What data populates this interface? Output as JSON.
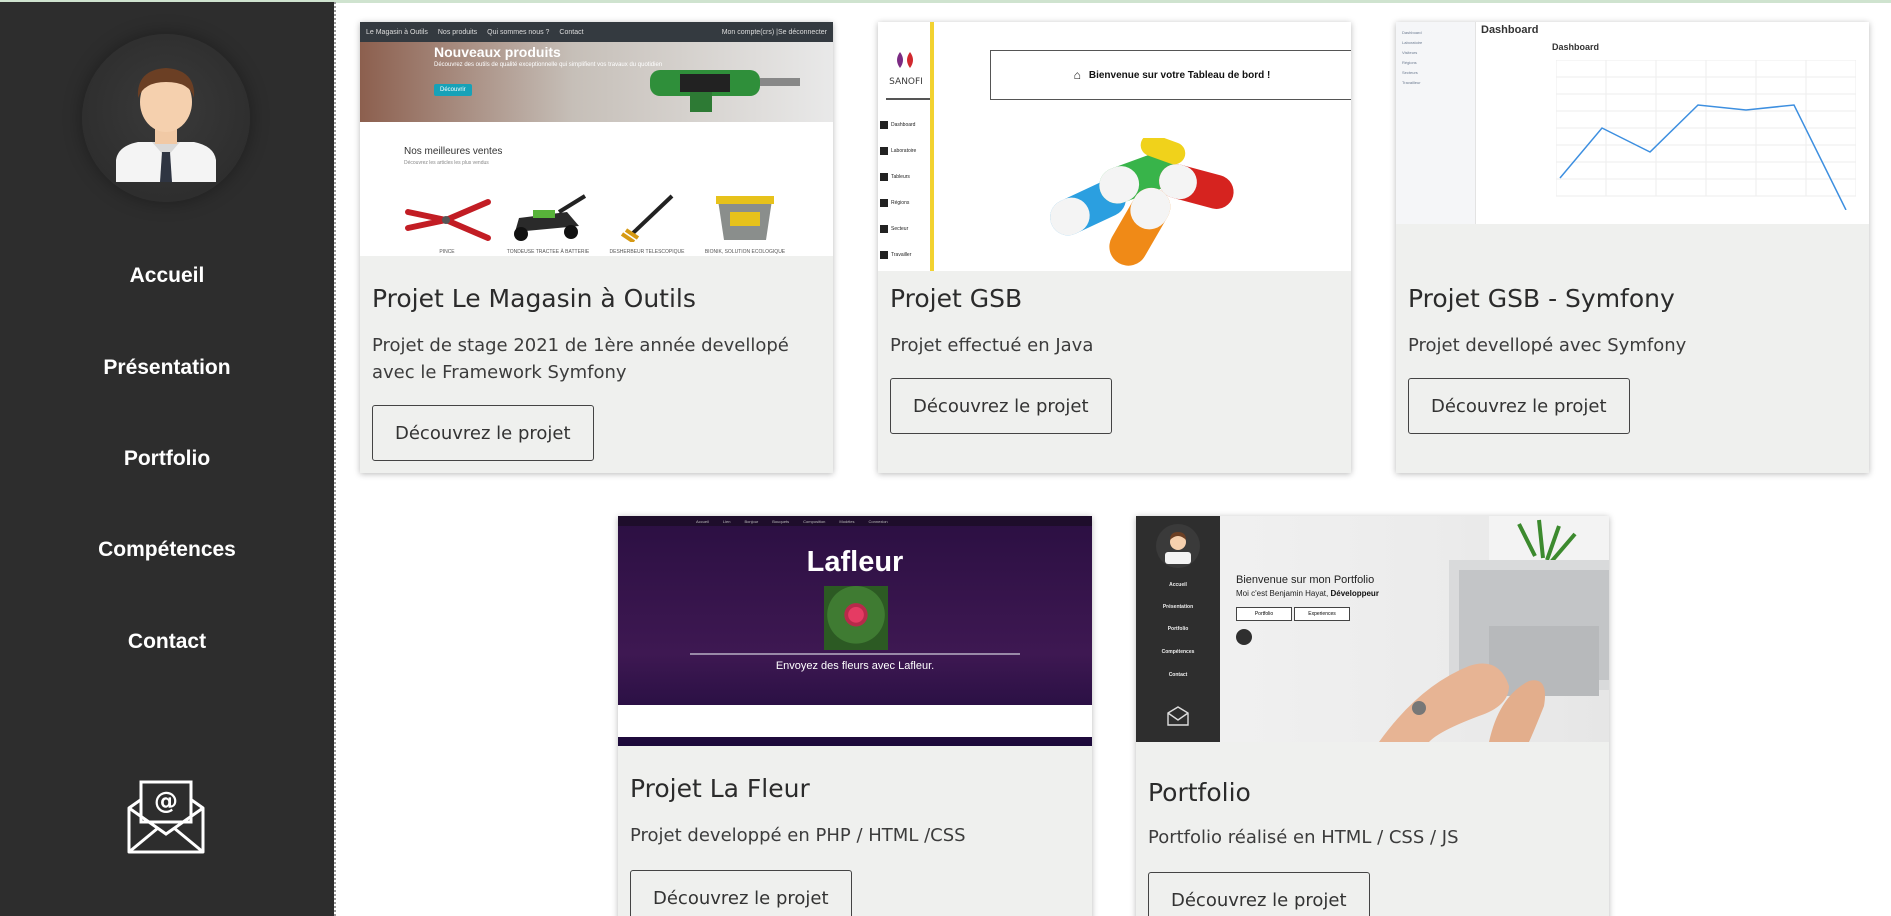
{
  "sidebar": {
    "nav": [
      "Accueil",
      "Présentation",
      "Portfolio",
      "Compétences",
      "Contact"
    ]
  },
  "cards": [
    {
      "title": "Projet Le Magasin à Outils",
      "desc": "Projet de stage 2021 de 1ère année devellopé avec le Framework Symfony",
      "button": "Découvrez le projet",
      "thumb": {
        "brand": "Le Magasin à Outils",
        "menu": [
          "Nos produits",
          "Qui sommes nous ?",
          "Contact"
        ],
        "account": "Mon compte(crs) |Se déconnecter",
        "hero_title": "Nouveaux produits",
        "hero_sub": "Découvrez des outils de qualité exceptionnelle qui simplifient vos travaux du quotidien",
        "hero_btn": "Découvrir",
        "section": "Nos meilleures ventes",
        "section_sub": "Découvrez les articles les plus vendus",
        "products": [
          "PINCE",
          "TONDEUSE TRACTEE À BATTERIE",
          "DESHERBEUR TELESCOPIQUE",
          "BIONIK, SOLUTION ECOLOGIQUE"
        ]
      }
    },
    {
      "title": "Projet GSB",
      "desc": "Projet effectué en Java",
      "button": "Découvrez le projet",
      "thumb": {
        "logo": "SANOFI",
        "banner": "Bienvenue sur votre Tableau de bord !",
        "menu": [
          "Dashboard",
          "Laboratoire",
          "Tableurs",
          "Régions",
          "Secteur",
          "Travailler"
        ]
      }
    },
    {
      "title": "Projet GSB - Symfony",
      "desc": "Projet devellopé avec Symfony",
      "button": "Découvrez le projet",
      "thumb": {
        "page_title": "Dashboard",
        "chart_title": "Dashboard",
        "menu": [
          "Dashboard",
          "Laboratoire",
          "Visiteurs",
          "Régions",
          "Secteurs",
          "Travailleur"
        ]
      }
    },
    {
      "title": "Projet La Fleur",
      "desc": "Projet developpé en PHP / HTML /CSS",
      "button": "Découvrez le projet",
      "thumb": {
        "menu": [
          "Accueil",
          "Lien",
          "Bonjour",
          "Bouquets",
          "Composition",
          "Modèles",
          "Connexion"
        ],
        "title": "Lafleur",
        "tagline": "Envoyez des fleurs avec Lafleur."
      }
    },
    {
      "title": "Portfolio",
      "desc": "Portfolio réalisé en HTML / CSS / JS",
      "button": "Découvrez le projet",
      "thumb": {
        "menu": [
          "Accueil",
          "Présentation",
          "Portfolio",
          "Compétences",
          "Contact"
        ],
        "heading": "Bienvenue sur mon Portfolio",
        "intro": "Moi c'est Benjamin Hayat,",
        "role": "Développeur",
        "buttons": [
          "Portfolio",
          "Experiences"
        ]
      }
    }
  ]
}
